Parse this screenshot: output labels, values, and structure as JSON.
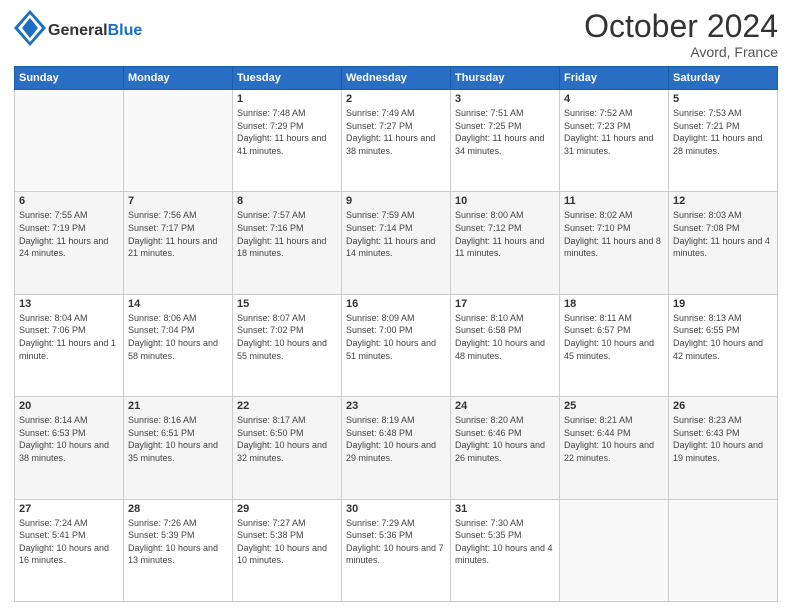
{
  "header": {
    "logo_general": "General",
    "logo_blue": "Blue",
    "month": "October 2024",
    "location": "Avord, France"
  },
  "days_of_week": [
    "Sunday",
    "Monday",
    "Tuesday",
    "Wednesday",
    "Thursday",
    "Friday",
    "Saturday"
  ],
  "weeks": [
    [
      {
        "day": "",
        "sunrise": "",
        "sunset": "",
        "daylight": ""
      },
      {
        "day": "",
        "sunrise": "",
        "sunset": "",
        "daylight": ""
      },
      {
        "day": "1",
        "sunrise": "Sunrise: 7:48 AM",
        "sunset": "Sunset: 7:29 PM",
        "daylight": "Daylight: 11 hours and 41 minutes."
      },
      {
        "day": "2",
        "sunrise": "Sunrise: 7:49 AM",
        "sunset": "Sunset: 7:27 PM",
        "daylight": "Daylight: 11 hours and 38 minutes."
      },
      {
        "day": "3",
        "sunrise": "Sunrise: 7:51 AM",
        "sunset": "Sunset: 7:25 PM",
        "daylight": "Daylight: 11 hours and 34 minutes."
      },
      {
        "day": "4",
        "sunrise": "Sunrise: 7:52 AM",
        "sunset": "Sunset: 7:23 PM",
        "daylight": "Daylight: 11 hours and 31 minutes."
      },
      {
        "day": "5",
        "sunrise": "Sunrise: 7:53 AM",
        "sunset": "Sunset: 7:21 PM",
        "daylight": "Daylight: 11 hours and 28 minutes."
      }
    ],
    [
      {
        "day": "6",
        "sunrise": "Sunrise: 7:55 AM",
        "sunset": "Sunset: 7:19 PM",
        "daylight": "Daylight: 11 hours and 24 minutes."
      },
      {
        "day": "7",
        "sunrise": "Sunrise: 7:56 AM",
        "sunset": "Sunset: 7:17 PM",
        "daylight": "Daylight: 11 hours and 21 minutes."
      },
      {
        "day": "8",
        "sunrise": "Sunrise: 7:57 AM",
        "sunset": "Sunset: 7:16 PM",
        "daylight": "Daylight: 11 hours and 18 minutes."
      },
      {
        "day": "9",
        "sunrise": "Sunrise: 7:59 AM",
        "sunset": "Sunset: 7:14 PM",
        "daylight": "Daylight: 11 hours and 14 minutes."
      },
      {
        "day": "10",
        "sunrise": "Sunrise: 8:00 AM",
        "sunset": "Sunset: 7:12 PM",
        "daylight": "Daylight: 11 hours and 11 minutes."
      },
      {
        "day": "11",
        "sunrise": "Sunrise: 8:02 AM",
        "sunset": "Sunset: 7:10 PM",
        "daylight": "Daylight: 11 hours and 8 minutes."
      },
      {
        "day": "12",
        "sunrise": "Sunrise: 8:03 AM",
        "sunset": "Sunset: 7:08 PM",
        "daylight": "Daylight: 11 hours and 4 minutes."
      }
    ],
    [
      {
        "day": "13",
        "sunrise": "Sunrise: 8:04 AM",
        "sunset": "Sunset: 7:06 PM",
        "daylight": "Daylight: 11 hours and 1 minute."
      },
      {
        "day": "14",
        "sunrise": "Sunrise: 8:06 AM",
        "sunset": "Sunset: 7:04 PM",
        "daylight": "Daylight: 10 hours and 58 minutes."
      },
      {
        "day": "15",
        "sunrise": "Sunrise: 8:07 AM",
        "sunset": "Sunset: 7:02 PM",
        "daylight": "Daylight: 10 hours and 55 minutes."
      },
      {
        "day": "16",
        "sunrise": "Sunrise: 8:09 AM",
        "sunset": "Sunset: 7:00 PM",
        "daylight": "Daylight: 10 hours and 51 minutes."
      },
      {
        "day": "17",
        "sunrise": "Sunrise: 8:10 AM",
        "sunset": "Sunset: 6:58 PM",
        "daylight": "Daylight: 10 hours and 48 minutes."
      },
      {
        "day": "18",
        "sunrise": "Sunrise: 8:11 AM",
        "sunset": "Sunset: 6:57 PM",
        "daylight": "Daylight: 10 hours and 45 minutes."
      },
      {
        "day": "19",
        "sunrise": "Sunrise: 8:13 AM",
        "sunset": "Sunset: 6:55 PM",
        "daylight": "Daylight: 10 hours and 42 minutes."
      }
    ],
    [
      {
        "day": "20",
        "sunrise": "Sunrise: 8:14 AM",
        "sunset": "Sunset: 6:53 PM",
        "daylight": "Daylight: 10 hours and 38 minutes."
      },
      {
        "day": "21",
        "sunrise": "Sunrise: 8:16 AM",
        "sunset": "Sunset: 6:51 PM",
        "daylight": "Daylight: 10 hours and 35 minutes."
      },
      {
        "day": "22",
        "sunrise": "Sunrise: 8:17 AM",
        "sunset": "Sunset: 6:50 PM",
        "daylight": "Daylight: 10 hours and 32 minutes."
      },
      {
        "day": "23",
        "sunrise": "Sunrise: 8:19 AM",
        "sunset": "Sunset: 6:48 PM",
        "daylight": "Daylight: 10 hours and 29 minutes."
      },
      {
        "day": "24",
        "sunrise": "Sunrise: 8:20 AM",
        "sunset": "Sunset: 6:46 PM",
        "daylight": "Daylight: 10 hours and 26 minutes."
      },
      {
        "day": "25",
        "sunrise": "Sunrise: 8:21 AM",
        "sunset": "Sunset: 6:44 PM",
        "daylight": "Daylight: 10 hours and 22 minutes."
      },
      {
        "day": "26",
        "sunrise": "Sunrise: 8:23 AM",
        "sunset": "Sunset: 6:43 PM",
        "daylight": "Daylight: 10 hours and 19 minutes."
      }
    ],
    [
      {
        "day": "27",
        "sunrise": "Sunrise: 7:24 AM",
        "sunset": "Sunset: 5:41 PM",
        "daylight": "Daylight: 10 hours and 16 minutes."
      },
      {
        "day": "28",
        "sunrise": "Sunrise: 7:26 AM",
        "sunset": "Sunset: 5:39 PM",
        "daylight": "Daylight: 10 hours and 13 minutes."
      },
      {
        "day": "29",
        "sunrise": "Sunrise: 7:27 AM",
        "sunset": "Sunset: 5:38 PM",
        "daylight": "Daylight: 10 hours and 10 minutes."
      },
      {
        "day": "30",
        "sunrise": "Sunrise: 7:29 AM",
        "sunset": "Sunset: 5:36 PM",
        "daylight": "Daylight: 10 hours and 7 minutes."
      },
      {
        "day": "31",
        "sunrise": "Sunrise: 7:30 AM",
        "sunset": "Sunset: 5:35 PM",
        "daylight": "Daylight: 10 hours and 4 minutes."
      },
      {
        "day": "",
        "sunrise": "",
        "sunset": "",
        "daylight": ""
      },
      {
        "day": "",
        "sunrise": "",
        "sunset": "",
        "daylight": ""
      }
    ]
  ]
}
